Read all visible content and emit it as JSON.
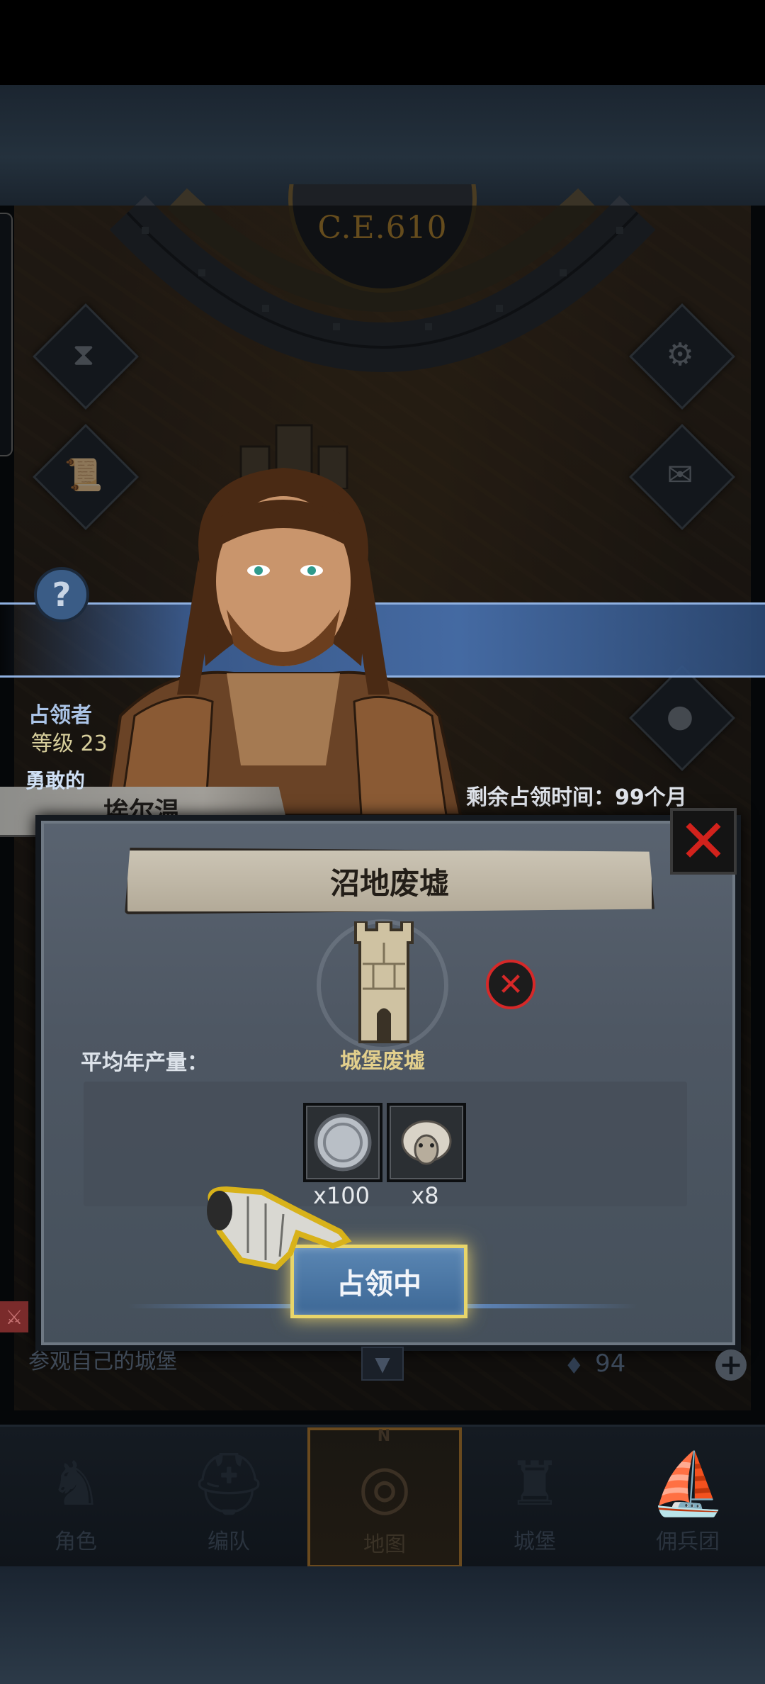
{
  "era": {
    "label": "C.E.610"
  },
  "occupier": {
    "label": "占领者",
    "level_label": "等级",
    "level_value": "23",
    "title": "勇敢的",
    "name": "埃尔温",
    "remaining_time": "剩余占领时间：99个月"
  },
  "dialog": {
    "title": "沼地废墟",
    "building_name": "城堡废墟",
    "yield_label": "平均年产量：",
    "resources": [
      {
        "icon": "silver-coin-icon",
        "count": "x100"
      },
      {
        "icon": "sheep-icon",
        "count": "x8"
      }
    ],
    "occupy_button": "占领中"
  },
  "bottom_info": {
    "visit_text": "参观自己的城堡",
    "gem_count": "94"
  },
  "nav": [
    {
      "label": "角色",
      "icon": "knight-icon"
    },
    {
      "label": "编队",
      "icon": "helmet-icon"
    },
    {
      "label": "地图",
      "icon": "compass-icon",
      "active": true
    },
    {
      "label": "城堡",
      "icon": "castle-icon"
    },
    {
      "label": "佣兵团",
      "icon": "ship-icon"
    }
  ],
  "colors": {
    "accent_gold": "#e8d56a",
    "close_red": "#d2221c",
    "button_blue": "#4a78a8"
  }
}
